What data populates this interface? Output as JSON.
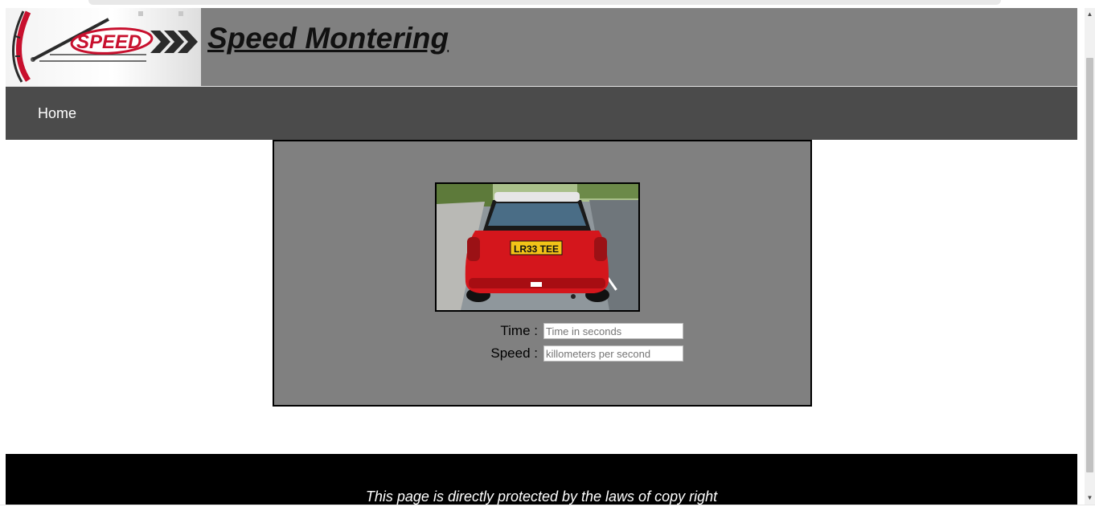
{
  "header": {
    "logo_text": "SPEED",
    "title": "Speed Montering"
  },
  "nav": {
    "home_label": "Home"
  },
  "main": {
    "car_image": {
      "plate_text": "LR33 TEE",
      "car_color": "#d4161c"
    },
    "time_label": "Time :",
    "time_placeholder": "Time in seconds",
    "speed_label": "Speed :",
    "speed_placeholder": "killometers per second"
  },
  "footer": {
    "text": "This page is directly protected by the laws of copy right"
  },
  "colors": {
    "header_bg": "#808080",
    "nav_bg": "#4b4b4b",
    "panel_bg": "#808080",
    "footer_bg": "#000000",
    "logo_red": "#c8102e"
  },
  "icons": {
    "scroll_up": "scroll-up-arrow-icon",
    "scroll_down": "scroll-down-arrow-icon"
  }
}
